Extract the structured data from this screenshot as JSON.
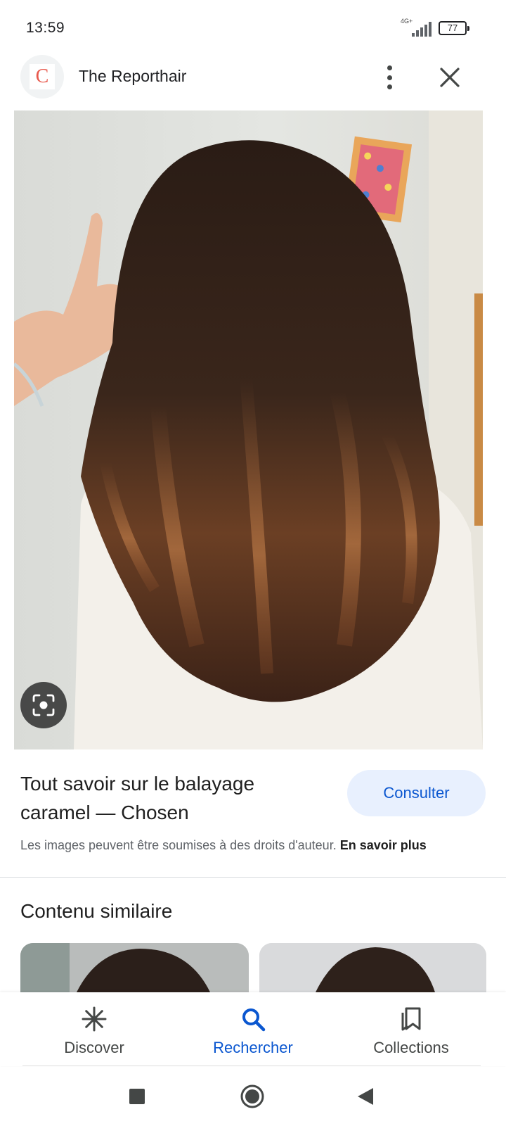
{
  "status_bar": {
    "time": "13:59",
    "network": "4G+",
    "battery": "77"
  },
  "header": {
    "site_logo_letter": "C",
    "site_name": "The Reporthair",
    "more_icon": "more-vert-icon",
    "close_icon": "close-icon"
  },
  "image": {
    "lens_icon": "lens-search-icon"
  },
  "result": {
    "title": "Tout savoir sur le balayage caramel — Chosen",
    "visit_label": "Consulter",
    "copyright_text": "Les images peuvent être soumises à des droits d'auteur.",
    "learn_more": "En savoir plus"
  },
  "similar": {
    "title": "Contenu similaire"
  },
  "bottom_nav": {
    "items": [
      {
        "label": "Discover",
        "icon": "asterisk-icon",
        "active": false
      },
      {
        "label": "Rechercher",
        "icon": "search-icon",
        "active": true
      },
      {
        "label": "Collections",
        "icon": "collections-bookmark-icon",
        "active": false
      }
    ]
  },
  "system_nav": {
    "recents": "square-icon",
    "home": "circle-icon",
    "back": "triangle-back-icon"
  },
  "colors": {
    "accent": "#0b57d0",
    "accent_container": "#e8f0fe",
    "logo_red": "#e8594d"
  }
}
